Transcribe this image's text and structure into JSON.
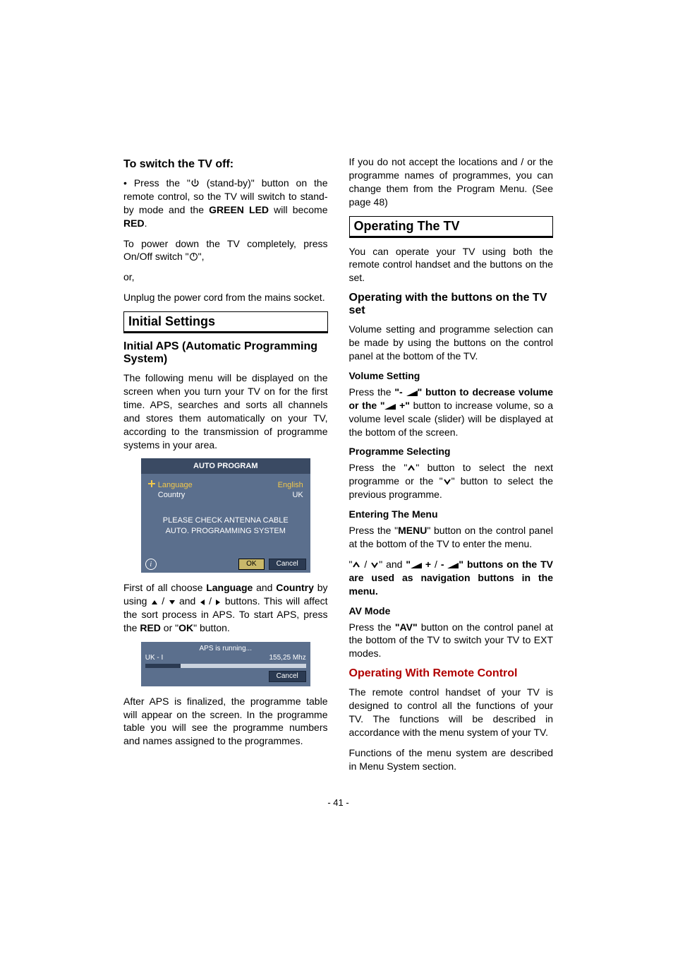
{
  "left": {
    "h_switch_off": "To switch the TV off:",
    "p1_a": "• Press the \"",
    "p1_b": " (stand-by)\" button on the remote control, so the TV will switch to stand-by mode and the ",
    "p1_green": "GREEN LED",
    "p1_c": " will become ",
    "p1_red": "RED",
    "p1_d": ".",
    "p2_a": "To power down the TV completely, press On/Off switch \"",
    "p2_b": "\",",
    "p3": "or,",
    "p4": "Unplug the power cord from the mains socket.",
    "h_initial_settings": "Initial Settings",
    "h_initial_aps": "Initial APS (Automatic Programming System)",
    "p5": "The following menu will be displayed on the screen when you turn your TV on for the first time. APS, searches and sorts all channels and stores them automatically on your TV, according to the transmission of programme systems in your area.",
    "auto_program": {
      "title": "AUTO PROGRAM",
      "language_label": "Language",
      "language_value": "English",
      "country_label": "Country",
      "country_value": "UK",
      "msg1": "PLEASE CHECK ANTENNA CABLE",
      "msg2": "AUTO. PROGRAMMING SYSTEM",
      "ok": "OK",
      "cancel": "Cancel"
    },
    "p6_a": "First of all choose ",
    "p6_lang": "Language",
    "p6_b": " and ",
    "p6_country": "Country",
    "p6_c": " by using ",
    "p6_d": " / ",
    "p6_e": " and ",
    "p6_f": " / ",
    "p6_g": " buttons. This will affect the sort process in APS. To start APS, press the ",
    "p6_red": "RED",
    "p6_h": " or \"",
    "p6_ok": "OK",
    "p6_i": "\" button.",
    "run": {
      "title": "APS is running...",
      "left": "UK  -  I",
      "right": "155,25  Mhz",
      "cancel": "Cancel"
    },
    "p7": "After APS is finalized, the programme table will appear on the screen. In the programme table you will see the programme numbers and names assigned to the programmes."
  },
  "right": {
    "p1": "If you do not accept the locations and / or the programme names of programmes, you can change them from the Program Menu. (See page 48)",
    "h_operating": "Operating The TV",
    "p2": "You can operate your TV using both the remote control handset and the buttons on the set.",
    "h_op_buttons": "Operating with the buttons on the TV set",
    "p3": "Volume setting and programme selection can be made by using the buttons on the control panel at the bottom of the TV.",
    "h_volume": "Volume Setting",
    "p4_a": "Press the ",
    "p4_minus": "\"- ",
    "p4_b": "\" button to decrease volume or the ",
    "p4_plus": "\"",
    "p4_plus2": " +\"",
    "p4_c": " button to increase volume, so a volume level scale (slider) will be displayed at the bottom of the screen.",
    "h_prog": "Programme Selecting",
    "p5_a": "Press the \"",
    "p5_b": "\" button to select the next programme or the \"",
    "p5_c": "\" button to select the previous programme.",
    "h_menu": "Entering The Menu",
    "p6_a": "Press the \"",
    "p6_menu": "MENU",
    "p6_b": "\" button on the control panel at the bottom of the TV to enter the menu.",
    "p7_a": "\"",
    "p7_b": " / ",
    "p7_c": "\" and ",
    "p7_plus": "\"",
    "p7_plus2": " +",
    "p7_d": " / ",
    "p7_minus": "- ",
    "p7_e": "\" buttons on the TV are used as navigation buttons in the menu.",
    "h_av": "AV Mode",
    "p8_a": "Press the ",
    "p8_av": "\"AV\"",
    "p8_b": " button on the control panel at the bottom of the TV to switch your TV to EXT modes.",
    "h_remote": "Operating With Remote Control",
    "p9": "The remote control handset of your TV is designed to control all the functions of your TV. The functions will be described in accordance with the menu system of your TV.",
    "p10": "Functions of the menu system are described in Menu System section."
  },
  "page_number": "- 41 -"
}
